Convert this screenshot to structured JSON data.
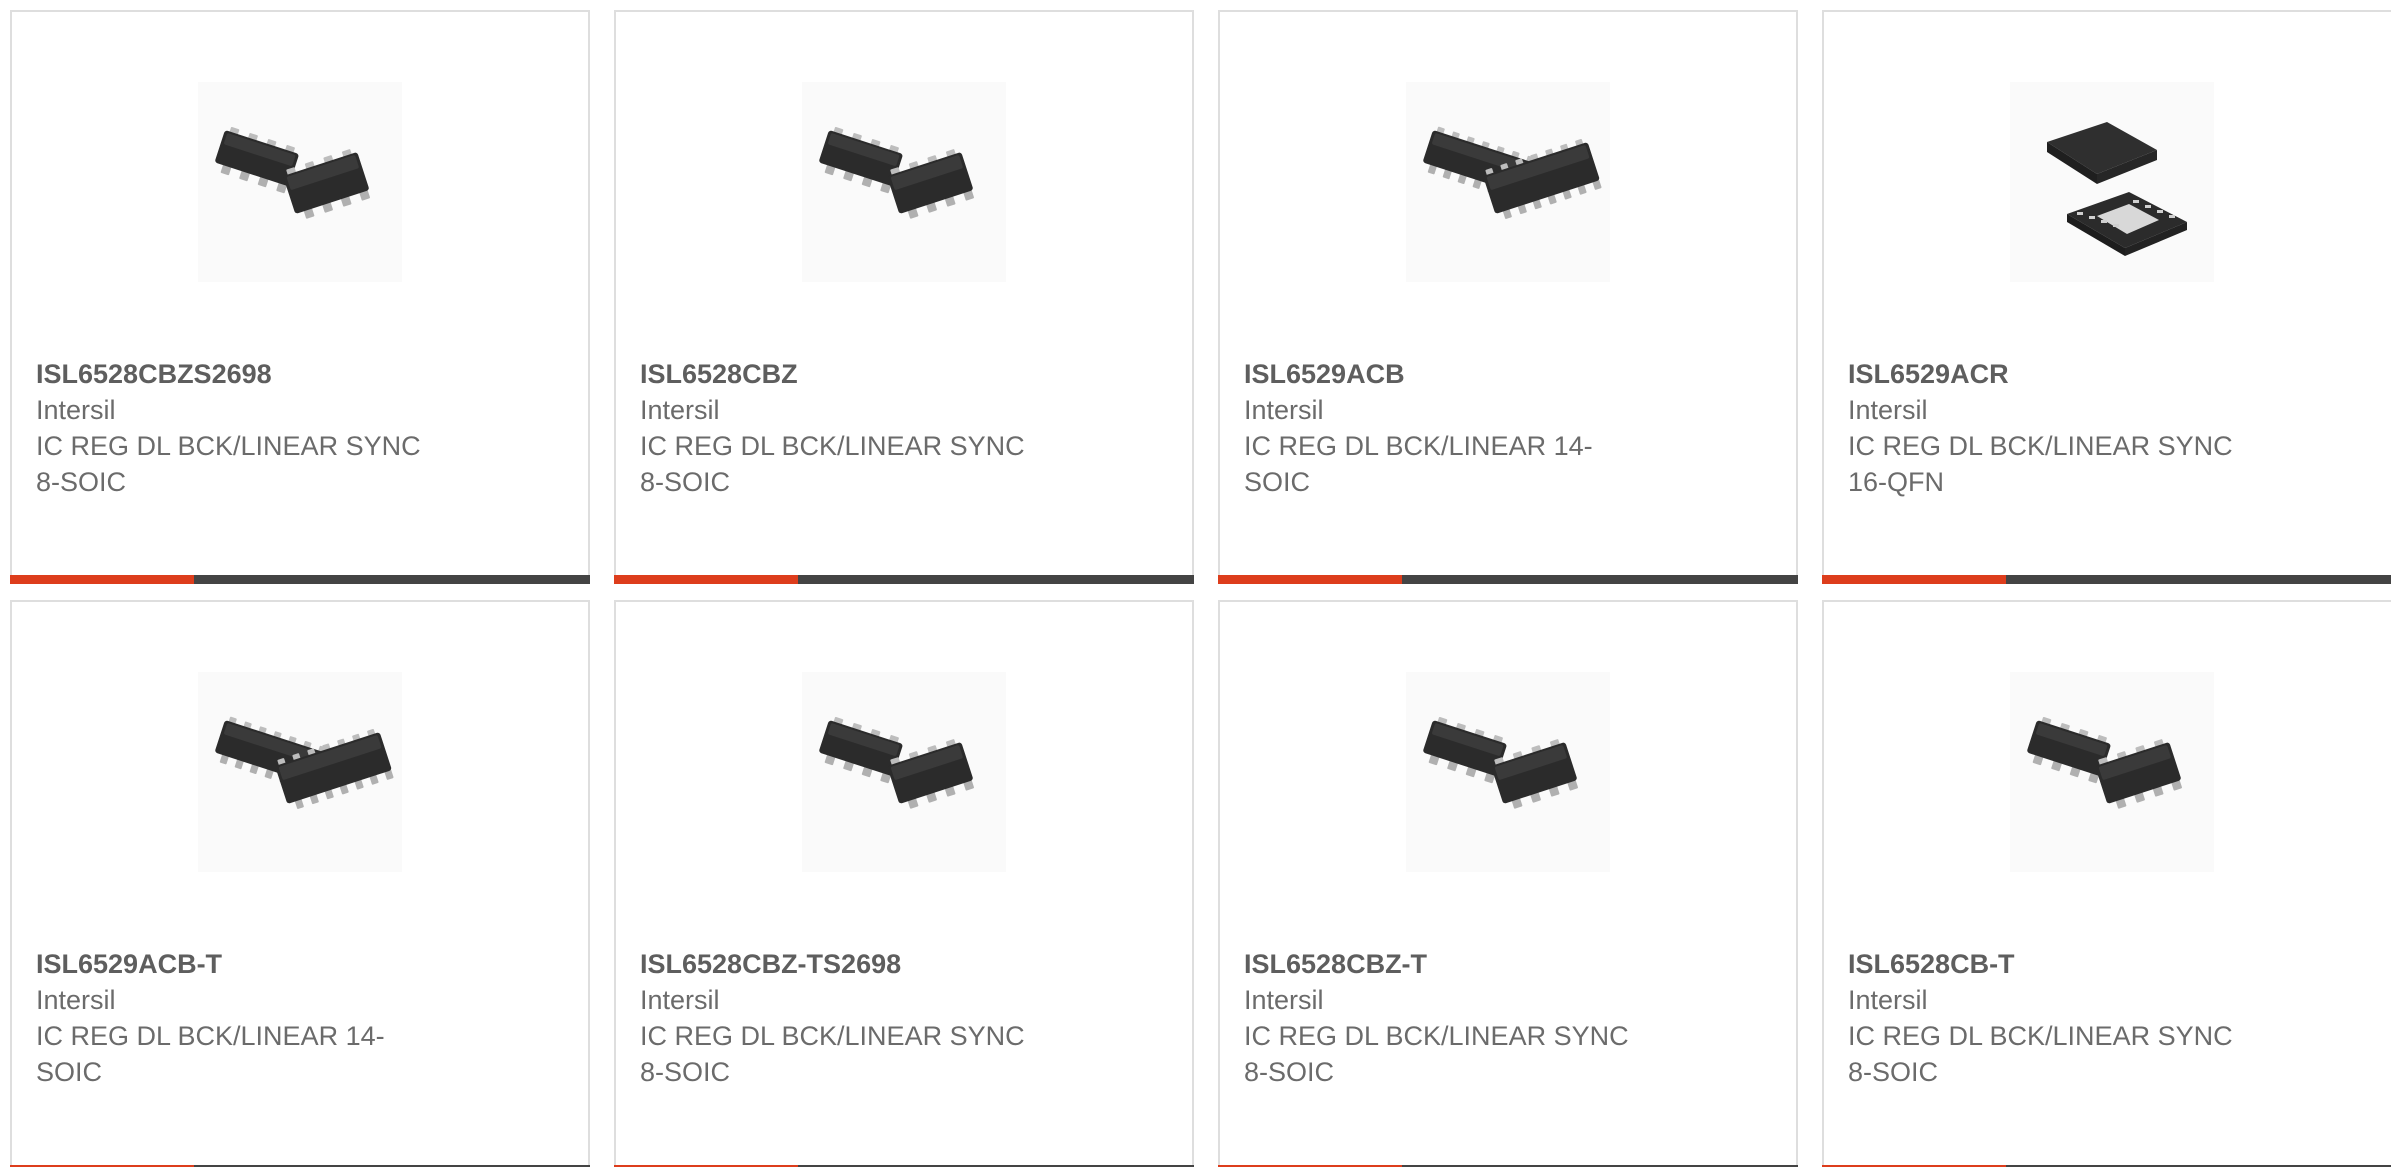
{
  "colors": {
    "accent": "#dd3d1c",
    "bar": "#444444",
    "border": "#dedede",
    "text": "#6b6b6b"
  },
  "products": [
    {
      "part_number": "ISL6528CBZS2698",
      "manufacturer": "Intersil",
      "description": "IC REG DL BCK/LINEAR SYNC\n8-SOIC",
      "image_icon": "soic-8-chip-icon"
    },
    {
      "part_number": "ISL6528CBZ",
      "manufacturer": "Intersil",
      "description": "IC REG DL BCK/LINEAR SYNC\n8-SOIC",
      "image_icon": "soic-8-chip-icon"
    },
    {
      "part_number": "ISL6529ACB",
      "manufacturer": "Intersil",
      "description": "IC REG DL BCK/LINEAR 14-\nSOIC",
      "image_icon": "soic-14-chip-icon"
    },
    {
      "part_number": "ISL6529ACR",
      "manufacturer": "Intersil",
      "description": "IC REG DL BCK/LINEAR SYNC\n16-QFN",
      "image_icon": "qfn-16-chip-icon"
    },
    {
      "part_number": "ISL6529ACB-T",
      "manufacturer": "Intersil",
      "description": "IC REG DL BCK/LINEAR 14-\nSOIC",
      "image_icon": "soic-14-chip-icon"
    },
    {
      "part_number": "ISL6528CBZ-TS2698",
      "manufacturer": "Intersil",
      "description": "IC REG DL BCK/LINEAR SYNC\n8-SOIC",
      "image_icon": "soic-8-chip-icon"
    },
    {
      "part_number": "ISL6528CBZ-T",
      "manufacturer": "Intersil",
      "description": "IC REG DL BCK/LINEAR SYNC\n8-SOIC",
      "image_icon": "soic-8-chip-icon"
    },
    {
      "part_number": "ISL6528CB-T",
      "manufacturer": "Intersil",
      "description": "IC REG DL BCK/LINEAR SYNC\n8-SOIC",
      "image_icon": "soic-8-chip-icon"
    }
  ]
}
